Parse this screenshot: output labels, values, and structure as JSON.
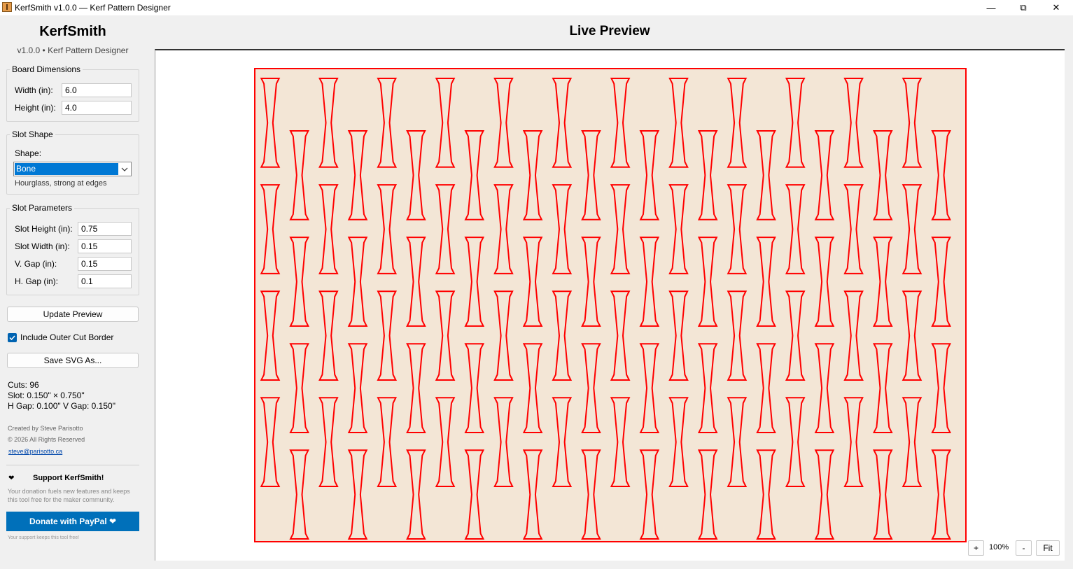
{
  "window": {
    "title": "KerfSmith v1.0.0 — Kerf Pattern Designer",
    "minimize": "—",
    "maximize": "⧉",
    "close": "✕"
  },
  "sidebar": {
    "app_name": "KerfSmith",
    "app_subtitle": "v1.0.0  •  Kerf Pattern Designer",
    "board": {
      "legend": "Board Dimensions",
      "width_label": "Width (in):",
      "width_value": "6.0",
      "height_label": "Height (in):",
      "height_value": "4.0"
    },
    "shape": {
      "legend": "Slot Shape",
      "shape_label": "Shape:",
      "selected": "Bone",
      "hint": "Hourglass, strong at edges"
    },
    "params": {
      "legend": "Slot Parameters",
      "slot_height_label": "Slot Height (in):",
      "slot_height_value": "0.75",
      "slot_width_label": "Slot Width (in):",
      "slot_width_value": "0.15",
      "v_gap_label": "V. Gap (in):",
      "v_gap_value": "0.15",
      "h_gap_label": "H. Gap (in):",
      "h_gap_value": "0.1"
    },
    "update_button": "Update Preview",
    "outer_border_label": "Include Outer Cut Border",
    "outer_border_checked": true,
    "save_button": "Save SVG As...",
    "stats": {
      "cuts": "Cuts: 96",
      "slot": "Slot: 0.150\" × 0.750\"",
      "gaps": "H Gap: 0.100\"  V Gap: 0.150\""
    },
    "credits": {
      "created_by": "Created by Steve Parisotto",
      "copyright": "© 2026 All Rights Reserved",
      "email": "steve@parisotto.ca"
    },
    "support": {
      "icon": "❤",
      "title": "Support KerfSmith!",
      "text": "Your donation fuels new features and keeps this tool free for the maker community.",
      "donate_button": "Donate with PayPal ❤",
      "footnote": "Your support keeps this tool free!"
    }
  },
  "preview": {
    "title": "Live Preview",
    "zoom_in": "+",
    "zoom_level": "100%",
    "zoom_out": "-",
    "fit": "Fit"
  },
  "pattern": {
    "board_width_in": 6.0,
    "board_height_in": 4.0,
    "slot_height_in": 0.75,
    "slot_width_in": 0.15,
    "v_gap_in": 0.15,
    "h_gap_in": 0.1,
    "cut_color": "#ff0000",
    "board_color": "#f3e6d6"
  }
}
